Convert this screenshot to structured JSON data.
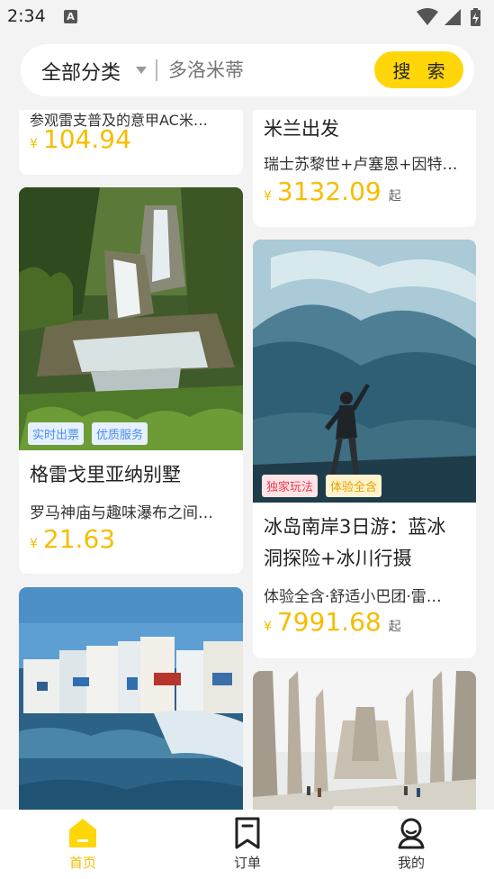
{
  "status": {
    "time": "2:34",
    "a_icon": "A"
  },
  "search": {
    "category": "全部分类",
    "placeholder": "多洛米蒂",
    "button": "搜 索"
  },
  "cards": {
    "left_top": {
      "sub": "参观雷支普及的意甲AC米…",
      "price": "104.94"
    },
    "right_top": {
      "title": "米兰出发",
      "sub": "瑞士苏黎世+卢塞恩+因特…",
      "price": "3132.09",
      "suffix": "起"
    },
    "left_mid": {
      "tags": [
        "实时出票",
        "优质服务"
      ],
      "title": "格雷戈里亚纳别墅",
      "sub": "罗马神庙与趣味瀑布之间…",
      "price": "21.63"
    },
    "right_mid": {
      "tags": [
        "独家玩法",
        "体验全含"
      ],
      "title_line1": "冰岛南岸3日游：蓝冰",
      "title_line2": "洞探险+冰川行摄",
      "sub": "体验全含·舒适小巴团·雷…",
      "price": "7991.68",
      "suffix": "起"
    }
  },
  "currency": "¥",
  "tabs": [
    {
      "label": "首页",
      "active": true
    },
    {
      "label": "订单",
      "active": false
    },
    {
      "label": "我的",
      "active": false
    }
  ],
  "colors": {
    "accent": "#ffd60a",
    "price": "#f6bd00"
  }
}
